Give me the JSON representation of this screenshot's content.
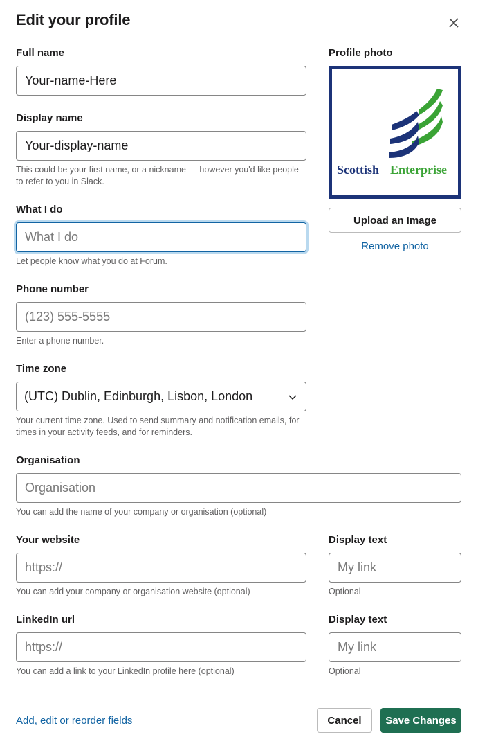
{
  "header": {
    "title": "Edit your profile",
    "close_icon": "close-icon"
  },
  "full_name": {
    "label": "Full name",
    "value": "Your-name-Here"
  },
  "display_name": {
    "label": "Display name",
    "value": "Your-display-name",
    "help": "This could be your first name, or a nickname — however you'd like people to refer to you in Slack."
  },
  "what_i_do": {
    "label": "What I do",
    "placeholder": "What I do",
    "help": "Let people know what you do at Forum."
  },
  "phone": {
    "label": "Phone number",
    "placeholder": "(123) 555-5555",
    "help": "Enter a phone number."
  },
  "time_zone": {
    "label": "Time zone",
    "selected": "(UTC) Dublin, Edinburgh, Lisbon, London",
    "help": "Your current time zone. Used to send summary and notification emails, for times in your activity feeds, and for reminders."
  },
  "organisation": {
    "label": "Organisation",
    "placeholder": "Organisation",
    "help": "You can add the name of your company or organisation (optional)"
  },
  "website": {
    "label": "Your website",
    "placeholder": "https://",
    "help": "You can add your company or organisation website (optional)",
    "display_label": "Display text",
    "display_placeholder": "My link",
    "display_help": "Optional"
  },
  "linkedin": {
    "label": "LinkedIn url",
    "placeholder": "https://",
    "help": "You can add a link to your LinkedIn profile here (optional)",
    "display_label": "Display text",
    "display_placeholder": "My link",
    "display_help": "Optional"
  },
  "profile_photo": {
    "label": "Profile photo",
    "logo_text_1": "Scottish",
    "logo_text_2": "Enterprise",
    "upload_label": "Upload an Image",
    "remove_label": "Remove photo",
    "colors": {
      "frame": "#1c3378",
      "blue": "#1c3378",
      "green": "#3aa335"
    }
  },
  "footer": {
    "fields_link": "Add, edit or reorder fields",
    "cancel_label": "Cancel",
    "save_label": "Save Changes"
  },
  "colors": {
    "link": "#1264a3",
    "primary": "#1f6f52",
    "focus_ring": "#b9d9ef"
  }
}
